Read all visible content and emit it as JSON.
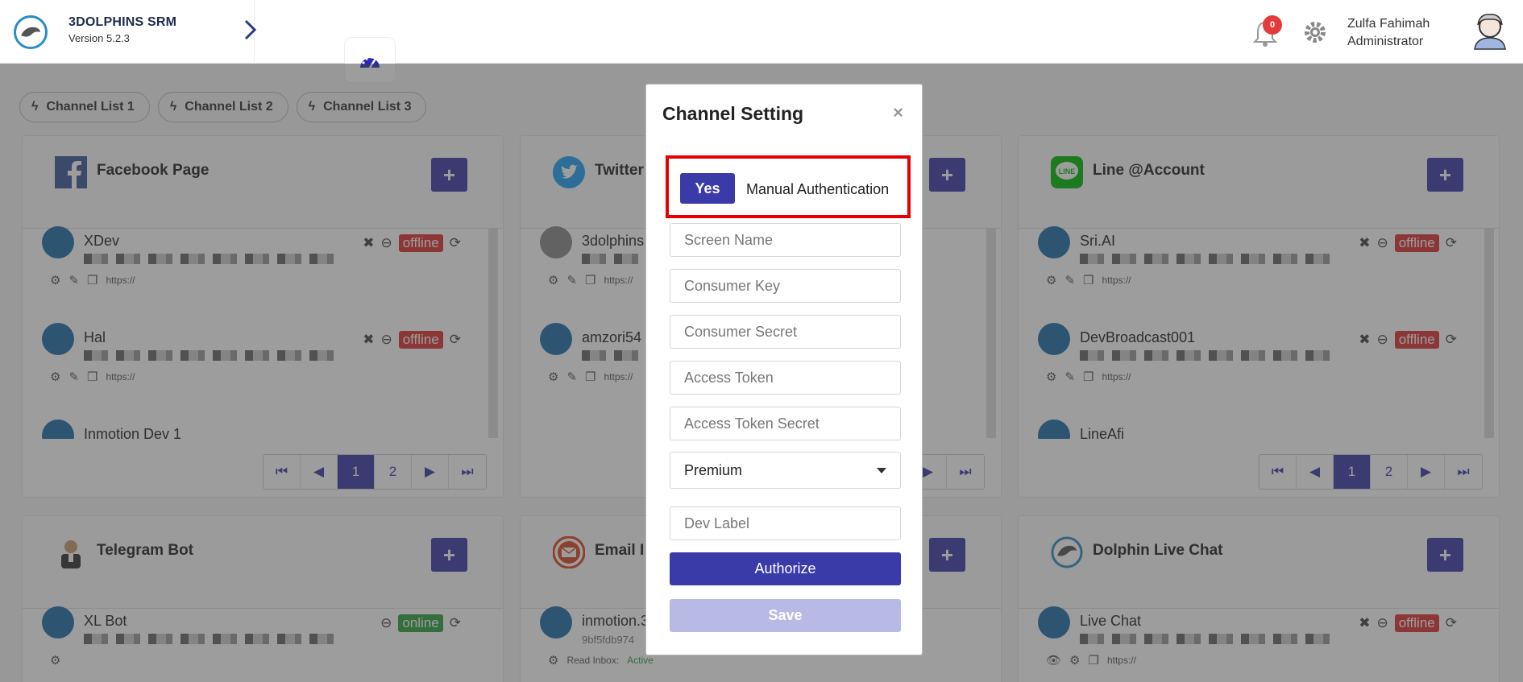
{
  "header": {
    "brand_title": "3DOLPHINS SRM",
    "brand_version": "Version 5.2.3",
    "notification_count": "0",
    "user_name": "Zulfa Fahimah",
    "user_role": "Administrator"
  },
  "tabs": [
    {
      "label": "Channel List 1"
    },
    {
      "label": "Channel List 2"
    },
    {
      "label": "Channel List 3"
    }
  ],
  "panels": {
    "facebook": {
      "title": "Facebook Page",
      "rows": [
        {
          "name": "XDev",
          "status": "offline",
          "link": "https://"
        },
        {
          "name": "Hal",
          "status": "offline",
          "link": "https://"
        },
        {
          "name": "Inmotion Dev 1"
        }
      ],
      "pages": [
        "1",
        "2"
      ]
    },
    "twitter": {
      "title": "Twitter",
      "rows": [
        {
          "name": "3dolphins",
          "link": "https://"
        },
        {
          "name": "amzori54",
          "link": "https://"
        }
      ]
    },
    "line": {
      "title": "Line @Account",
      "rows": [
        {
          "name": "Sri.AI",
          "status": "offline",
          "link": "https://"
        },
        {
          "name": "DevBroadcast001",
          "status": "offline",
          "link": "https://"
        },
        {
          "name": "LineAfi"
        }
      ],
      "pages": [
        "1",
        "2"
      ]
    },
    "telegram": {
      "title": "Telegram Bot",
      "rows": [
        {
          "name": "XL Bot",
          "status": "online"
        }
      ]
    },
    "email": {
      "title": "Email I",
      "rows": [
        {
          "name": "inmotion.3",
          "sub": "9bf5fdb974",
          "inbox_label": "Read Inbox:",
          "inbox_value": "Active"
        }
      ]
    },
    "livechat": {
      "title": "Dolphin Live Chat",
      "rows": [
        {
          "name": "Live Chat",
          "status": "offline",
          "link": "https://"
        }
      ]
    }
  },
  "modal": {
    "title": "Channel Setting",
    "close": "×",
    "auth_toggle": "Yes",
    "auth_label": "Manual Authentication",
    "fields": {
      "screen_name": "Screen Name",
      "consumer_key": "Consumer Key",
      "consumer_secret": "Consumer Secret",
      "access_token": "Access Token",
      "access_token_secret": "Access Token Secret",
      "dev_label": "Dev Label"
    },
    "tier_selected": "Premium",
    "authorize_label": "Authorize",
    "save_label": "Save"
  },
  "colors": {
    "primary": "#3a3aa8",
    "offline": "#dd3333",
    "online": "#2f9e3f",
    "highlight": "#e60000"
  }
}
